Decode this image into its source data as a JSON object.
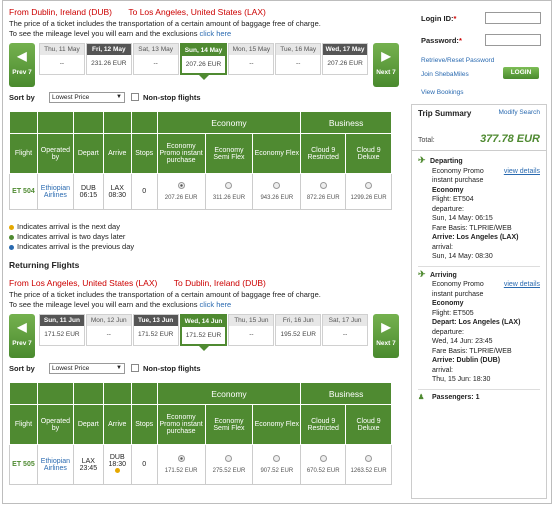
{
  "outbound": {
    "route_from": "From Dublin, Ireland (DUB)",
    "route_to": "To Los Angeles, United States (LAX)",
    "note1": "The price of a ticket includes the transportation of a certain amount of baggage free of charge.",
    "note2": "To see the mileage level you will earn and the exclusions",
    "note_link": "click here",
    "prev_label": "Prev 7",
    "next_label": "Next 7",
    "days": [
      {
        "label": "Thu, 11 May",
        "price": "--",
        "style": "light"
      },
      {
        "label": "Fri, 12 May",
        "price": "231.26 EUR",
        "style": "dark"
      },
      {
        "label": "Sat, 13 May",
        "price": "--",
        "style": "light"
      },
      {
        "label": "Sun, 14 May",
        "price": "207.26 EUR",
        "style": "sel"
      },
      {
        "label": "Mon, 15 May",
        "price": "--",
        "style": "light"
      },
      {
        "label": "Tue, 16 May",
        "price": "--",
        "style": "light"
      },
      {
        "label": "Wed, 17 May",
        "price": "207.26 EUR",
        "style": "dark"
      }
    ],
    "sort_label": "Sort by",
    "sort_value": "Lowest Price",
    "nonstop_label": "Non-stop flights",
    "headers": {
      "economy": "Economy",
      "business": "Business",
      "flight": "Flight",
      "operated": "Operated by",
      "depart": "Depart",
      "arrive": "Arrive",
      "stops": "Stops",
      "eco_promo": "Economy Promo instant purchase",
      "eco_semi": "Economy Semi Flex",
      "eco_flex": "Economy Flex",
      "c9_restricted": "Cloud 9 Restricted",
      "c9_deluxe": "Cloud 9 Deluxe"
    },
    "flight": {
      "number": "ET 504",
      "airline": "Ethiopian Airlines",
      "dep_code": "DUB",
      "dep_time": "06:15",
      "arr_code": "LAX",
      "arr_time": "08:30",
      "stops": "0",
      "prices": [
        "207.26 EUR",
        "311.26 EUR",
        "943.26 EUR",
        "872.26 EUR",
        "1299.26 EUR"
      ]
    }
  },
  "legend": {
    "next_day": "Indicates arrival is the next day",
    "two_days": "Indicates arrival is two days later",
    "prev_day": "Indicates arrival is the previous day",
    "color_next": "#e5a800",
    "color_two": "#4f8a31",
    "color_prev": "#2a6ab0"
  },
  "returning": {
    "title": "Returning Flights",
    "route_from": "From Los Angeles, United States (LAX)",
    "route_to": "To Dublin, Ireland (DUB)",
    "note1": "The price of a ticket includes the transportation of a certain amount of baggage free of charge.",
    "note2": "To see the mileage level you will earn and the exclusions",
    "note_link": "click here",
    "prev_label": "Prev 7",
    "next_label": "Next 7",
    "days": [
      {
        "label": "Sun, 11 Jun",
        "price": "171.52 EUR",
        "style": "dark"
      },
      {
        "label": "Mon, 12 Jun",
        "price": "--",
        "style": "light"
      },
      {
        "label": "Tue, 13 Jun",
        "price": "171.52 EUR",
        "style": "dark"
      },
      {
        "label": "Wed, 14 Jun",
        "price": "171.52 EUR",
        "style": "sel"
      },
      {
        "label": "Thu, 15 Jun",
        "price": "--",
        "style": "light"
      },
      {
        "label": "Fri, 16 Jun",
        "price": "195.52 EUR",
        "style": "light"
      },
      {
        "label": "Sat, 17 Jun",
        "price": "--",
        "style": "light"
      }
    ],
    "sort_label": "Sort by",
    "sort_value": "Lowest Price",
    "nonstop_label": "Non-stop flights",
    "flight": {
      "number": "ET 505",
      "airline": "Ethiopian Airlines",
      "dep_code": "LAX",
      "dep_time": "23:45",
      "arr_code": "DUB",
      "arr_time": "18:30",
      "stops": "0",
      "prices": [
        "171.52 EUR",
        "275.52 EUR",
        "907.52 EUR",
        "670.52 EUR",
        "1263.52 EUR"
      ]
    }
  },
  "login": {
    "id_label": "Login ID:",
    "pw_label": "Password:",
    "req": "*",
    "reset_link": "Retrieve/Reset Password",
    "join_link": "Join ShebaMiles",
    "button": "LOGIN",
    "bookings_link": "View Bookings"
  },
  "trip": {
    "title": "Trip Summary",
    "modify": "Modify Search",
    "total_label": "Total:",
    "total_value": "377.78 EUR",
    "departing": {
      "head": "Departing",
      "fare": "Economy Promo instant purchase",
      "details": "view details",
      "cabin": "Economy",
      "flight": "Flight: ET504",
      "dep_label": "departure:",
      "dep_value": "Sun, 14 May: 06:15",
      "basis": "Fare Basis: TLPRIE/WEB",
      "arrive": "Arrive: Los Angeles (LAX)",
      "arr_label": "arrival:",
      "arr_value": "Sun, 14 May: 08:30"
    },
    "arriving": {
      "head": "Arriving",
      "fare": "Economy Promo instant purchase",
      "details": "view details",
      "cabin": "Economy",
      "flight": "Flight: ET505",
      "depart": "Depart: Los Angeles (LAX)",
      "dep_label": "departure:",
      "dep_value": "Wed, 14 Jun: 23:45",
      "basis": "Fare Basis: TLPRIE/WEB",
      "arrive": "Arrive: Dublin (DUB)",
      "arr_label": "arrival:",
      "arr_value": "Thu, 15 Jun: 18:30"
    },
    "passengers": "Passengers: 1"
  }
}
